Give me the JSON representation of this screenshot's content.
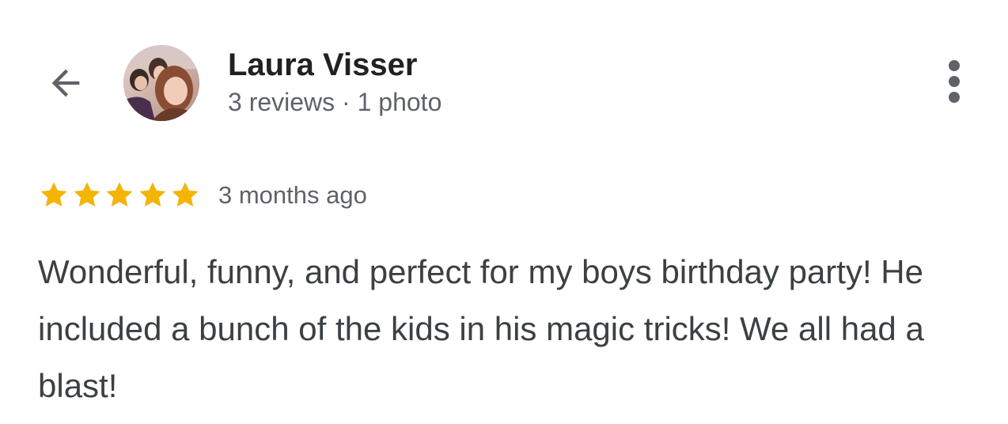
{
  "header": {
    "back_icon": "arrow-back-icon",
    "more_icon": "more-vert-icon",
    "reviewer": {
      "name": "Laura Visser",
      "meta": "3 reviews · 1 photo",
      "avatar_icon": "profile-photo"
    }
  },
  "review": {
    "rating": 5,
    "max_rating": 5,
    "star_color": "#f4b400",
    "date": "3 months ago",
    "text": "Wonderful, funny, and perfect for my boys birthday party! He included a bunch of the kids in his magic tricks! We all had a blast!"
  },
  "colors": {
    "name": "#202124",
    "secondary": "#5f6368",
    "body": "#3c4043",
    "icon": "#5f6368"
  }
}
